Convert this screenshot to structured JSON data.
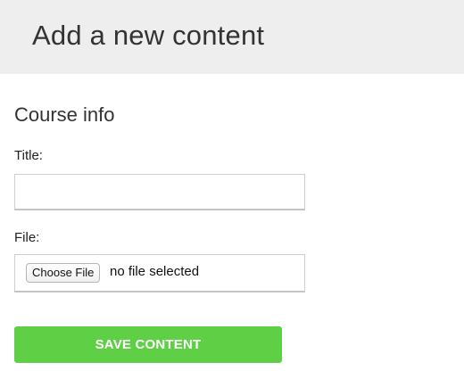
{
  "header": {
    "title": "Add a new content"
  },
  "form": {
    "section_title": "Course info",
    "title_label": "Title:",
    "title_value": "",
    "title_placeholder": "",
    "file_label": "File:",
    "choose_file_label": "Choose File",
    "file_status": "no file selected",
    "save_label": "SAVE CONTENT"
  },
  "colors": {
    "header_background": "#eeeeee",
    "save_button": "#5fd046"
  }
}
